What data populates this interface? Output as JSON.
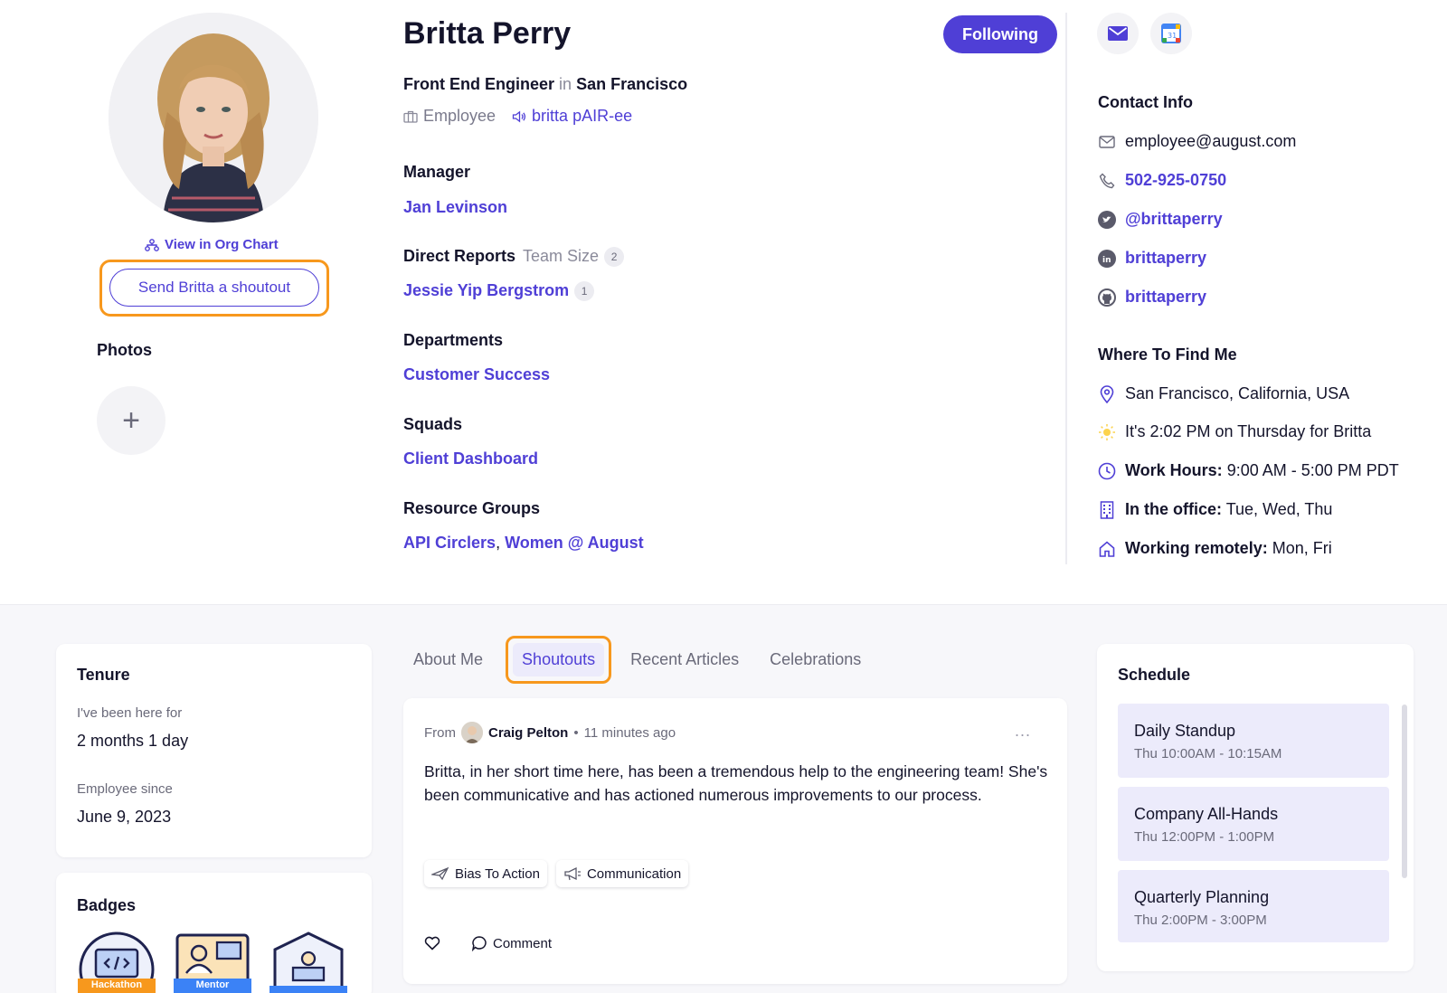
{
  "profile": {
    "name": "Britta Perry",
    "role": "Front End Engineer",
    "in_word": "in",
    "location": "San Francisco",
    "employment_type": "Employee",
    "pronunciation": "britta pAIR-ee",
    "follow_label": "Following",
    "org_chart_link": "View in Org Chart",
    "shoutout_button": "Send Britta a shoutout",
    "photos_title": "Photos",
    "add_photo": "+"
  },
  "sections": {
    "manager_label": "Manager",
    "manager": "Jan Levinson",
    "direct_reports_label": "Direct Reports",
    "team_size_label": "Team Size",
    "team_size": "2",
    "direct_report": "Jessie Yip Bergstrom",
    "direct_report_count": "1",
    "departments_label": "Departments",
    "department": "Customer Success",
    "squads_label": "Squads",
    "squad": "Client Dashboard",
    "resource_groups_label": "Resource Groups",
    "resource_group_1": "API Circlers",
    "resource_group_sep": ",",
    "resource_group_2": "Women @ August"
  },
  "contact": {
    "title": "Contact Info",
    "email": "employee@august.com",
    "phone": "502-925-0750",
    "twitter": "@brittaperry",
    "linkedin": "brittaperry",
    "github": "brittaperry"
  },
  "where": {
    "title": "Where To Find Me",
    "location": "San Francisco, California, USA",
    "local_time": "It's 2:02 PM on Thursday for Britta",
    "work_hours_label": "Work Hours:",
    "work_hours": "9:00 AM - 5:00 PM PDT",
    "office_label": "In the office:",
    "office_days": "Tue, Wed, Thu",
    "remote_label": "Working remotely:",
    "remote_days": "Mon, Fri"
  },
  "tenure": {
    "title": "Tenure",
    "here_for_label": "I've been here for",
    "here_for": "2 months 1 day",
    "since_label": "Employee since",
    "since": "June 9, 2023"
  },
  "badges": {
    "title": "Badges",
    "items": [
      "Hackathon",
      "Mentor",
      ""
    ]
  },
  "tabs": {
    "about": "About Me",
    "shoutouts": "Shoutouts",
    "articles": "Recent Articles",
    "celebrations": "Celebrations"
  },
  "shoutout_post": {
    "from_label": "From",
    "author": "Craig Pelton",
    "bullet": "•",
    "time_ago": "11 minutes ago",
    "more": "...",
    "body": "Britta, in her short time here, has been a tremendous help to the engineering team! She's been communicative and has actioned numerous improvements to our process.",
    "tags": [
      "Bias To Action",
      "Communication"
    ],
    "comment_label": "Comment"
  },
  "schedule": {
    "title": "Schedule",
    "items": [
      {
        "title": "Daily Standup",
        "time": "Thu 10:00AM - 10:15AM"
      },
      {
        "title": "Company All-Hands",
        "time": "Thu 12:00PM - 1:00PM"
      },
      {
        "title": "Quarterly Planning",
        "time": "Thu 2:00PM - 3:00PM"
      }
    ]
  },
  "colors": {
    "accent": "#4f3fd6",
    "highlight": "#f7981d",
    "schedule_bg": "#ecebfb",
    "page_bg": "#f7f7fa"
  }
}
